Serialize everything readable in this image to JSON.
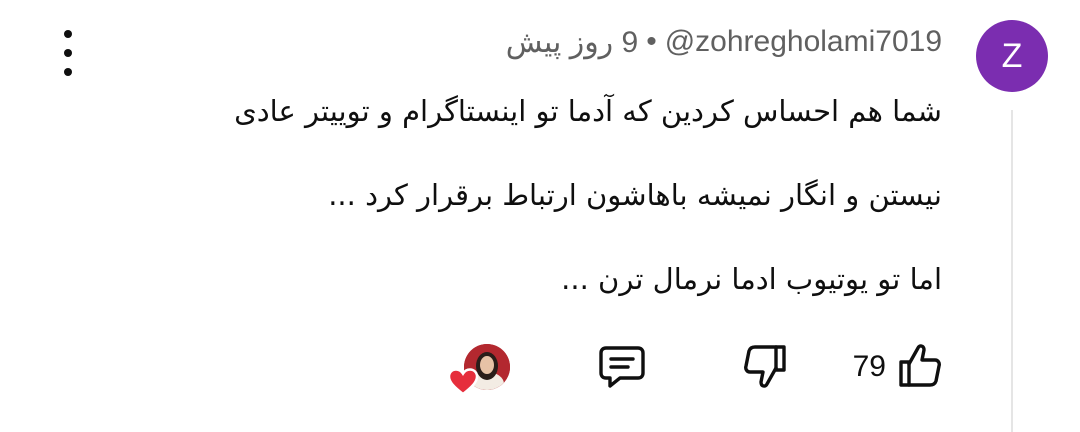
{
  "comment": {
    "avatar_letter": "Z",
    "avatar_color": "#7b2db0",
    "author": "@zohregholami7019",
    "separator": "•",
    "time": "9 روز پیش",
    "text_lines": [
      "شما هم احساس کردین که آدما تو اینستاگرام و توییتر عادی",
      "نیستن و انگار نمیشه باهاشون ارتباط برقرار کرد ...",
      "اما تو یوتیوب ادما نرمال ترن ..."
    ],
    "like_count": "79"
  },
  "icons": {
    "menu": "more-vertical-icon",
    "like": "thumbs-up-icon",
    "dislike": "thumbs-down-icon",
    "reply": "comment-reply-icon",
    "creator_heart": "creator-heart-icon"
  },
  "colors": {
    "heart": "#e62e3c",
    "meta_text": "#606060"
  }
}
